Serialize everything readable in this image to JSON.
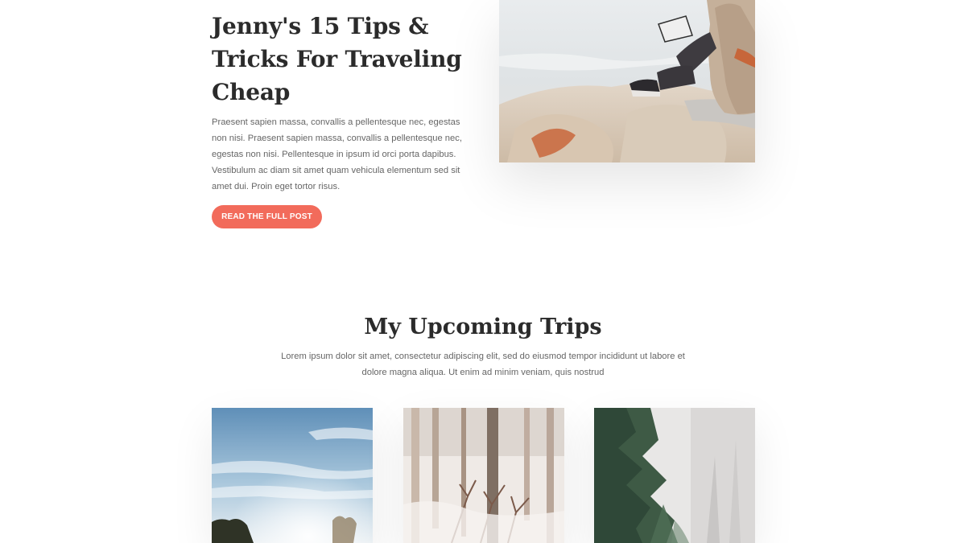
{
  "hero": {
    "title": "Jenny's 15 Tips & Tricks For Traveling Cheap",
    "body": "Praesent sapien massa, convallis a pellentesque nec, egestas non nisi. Praesent sapien massa, convallis a pellentesque nec, egestas non nisi. Pellentesque in ipsum id orci porta dapibus. Vestibulum ac diam sit amet quam vehicula elementum sed sit amet dui. Proin eget tortor risus.",
    "button_label": "READ THE FULL POST",
    "accent_color": "#f26b5b"
  },
  "upcoming": {
    "title": "My Upcoming Trips",
    "body": "Lorem ipsum dolor sit amet, consectetur adipiscing elit, sed do eiusmod tempor incididunt ut labore et dolore magna aliqua. Ut enim ad minim veniam, quis nostrud"
  }
}
